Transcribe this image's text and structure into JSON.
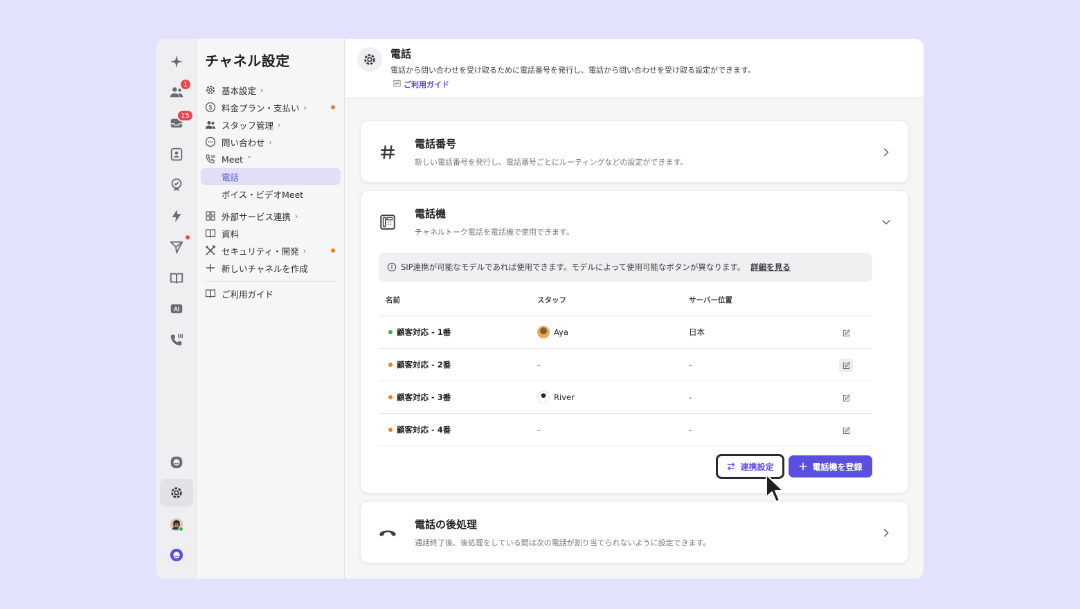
{
  "rail": {
    "inbox_badge": "1",
    "chat_badge": "15"
  },
  "nav": {
    "title": "チャネル設定",
    "items": [
      {
        "label": "基本設定",
        "icon": "gear-icon"
      },
      {
        "label": "料金プラン・支払い",
        "icon": "dollar-icon"
      },
      {
        "label": "スタッフ管理",
        "icon": "users-icon"
      },
      {
        "label": "問い合わせ",
        "icon": "chat-icon"
      },
      {
        "label": "Meet",
        "icon": "phone-icon"
      },
      {
        "label": "電話"
      },
      {
        "label": "ボイス・ビデオMeet"
      },
      {
        "label": "外部サービス連携",
        "icon": "grid-icon"
      },
      {
        "label": "資料",
        "icon": "book-icon"
      },
      {
        "label": "セキュリティ・開発",
        "icon": "tools-icon"
      },
      {
        "label": "新しいチャネルを作成",
        "icon": "plus-icon"
      },
      {
        "label": "ご利用ガイド",
        "icon": "book-icon"
      }
    ]
  },
  "header": {
    "title": "電話",
    "description": "電話から問い合わせを受け取るために電話番号を発行し、電話から問い合わせを受け取る設定ができます。",
    "guide_link": "ご利用ガイド"
  },
  "cards": {
    "phone_number": {
      "title": "電話番号",
      "description": "新しい電話番号を発行し、電話番号ごとにルーティングなどの設定ができます。"
    },
    "phone_device": {
      "title": "電話機",
      "description": "チャネルトーク電話を電話機で使用できます。",
      "info": "SIP連携が可能なモデルであれば使用できます。モデルによって使用可能なボタンが異なります。",
      "info_link": "詳細を見る",
      "columns": [
        "名前",
        "スタッフ",
        "サーバー位置"
      ],
      "rows": [
        {
          "name": "顧客対応 - 1番",
          "status_color": "#2fb34a",
          "staff": "Aya",
          "server": "日本"
        },
        {
          "name": "顧客対応 - 2番",
          "status_color": "#f07d1e",
          "staff": "-",
          "server": "-"
        },
        {
          "name": "顧客対応 - 3番",
          "status_color": "#f07d1e",
          "staff": "River",
          "server": "-"
        },
        {
          "name": "顧客対応 - 4番",
          "status_color": "#f07d1e",
          "staff": "-",
          "server": "-"
        }
      ],
      "link_button": "連携設定",
      "register_button": "電話機を登録"
    },
    "after_call": {
      "title": "電話の後処理",
      "description": "通話終了後、後処理をしている間は次の電話が割り当てられないように設定できます。"
    }
  },
  "colors": {
    "accent": "#5b4fe0",
    "badge": "#e5484d",
    "warning_dot": "#f07d1e",
    "online_dot": "#2fb34a"
  }
}
